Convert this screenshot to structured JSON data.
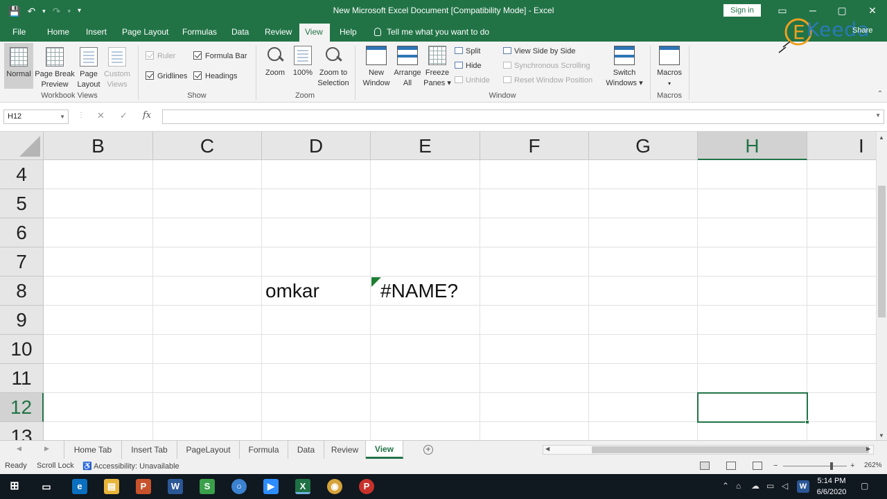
{
  "window": {
    "title": "New Microsoft Excel Document  [Compatibility Mode]  -  Excel",
    "signin": "Sign in",
    "share": "Share",
    "controls": [
      "─",
      "▢",
      "✕"
    ],
    "qat": [
      "💾",
      "↶",
      "▾",
      "↷",
      "▾"
    ]
  },
  "ribbon_tabs": [
    "File",
    "Home",
    "Insert",
    "Page Layout",
    "Formulas",
    "Data",
    "Review",
    "View",
    "Help"
  ],
  "active_tab": "View",
  "tell_me": "Tell me what you want to do",
  "ribbon": {
    "workbook_views": {
      "label": "Workbook Views",
      "normal": "Normal",
      "page_break_1": "Page Break",
      "page_break_2": "Preview",
      "page_layout_1": "Page",
      "page_layout_2": "Layout",
      "custom_1": "Custom",
      "custom_2": "Views"
    },
    "show": {
      "label": "Show",
      "ruler": "Ruler",
      "formula_bar": "Formula Bar",
      "gridlines": "Gridlines",
      "headings": "Headings"
    },
    "zoom": {
      "label": "Zoom",
      "zoom": "Zoom",
      "hundred": "100%",
      "zoom_sel_1": "Zoom to",
      "zoom_sel_2": "Selection"
    },
    "window": {
      "label": "Window",
      "new_1": "New",
      "new_2": "Window",
      "arrange_1": "Arrange",
      "arrange_2": "All",
      "freeze_1": "Freeze",
      "freeze_2": "Panes ▾",
      "split": "Split",
      "hide": "Hide",
      "unhide": "Unhide",
      "side_by_side": "View Side by Side",
      "sync_scroll": "Synchronous Scrolling",
      "reset_pos": "Reset Window Position",
      "switch_1": "Switch",
      "switch_2": "Windows ▾"
    },
    "macros": {
      "label": "Macros",
      "macros": "Macros",
      "arrow": "▾"
    }
  },
  "formula_bar": {
    "name_box": "H12",
    "cancel": "✕",
    "enter": "✓",
    "fx": "fx",
    "value": ""
  },
  "columns": [
    "B",
    "C",
    "D",
    "E",
    "F",
    "G",
    "H",
    "I"
  ],
  "rows": [
    "4",
    "5",
    "6",
    "7",
    "8",
    "9",
    "10",
    "11",
    "12",
    "13"
  ],
  "selected_column": "H",
  "selected_row": "12",
  "cells": {
    "D8": "omkar",
    "E8": "#NAME?"
  },
  "sheet_tabs": [
    "Home Tab",
    "Insert Tab",
    "PageLayout",
    "Formula",
    "Data",
    "Review",
    "View"
  ],
  "active_sheet": "View",
  "status": {
    "ready": "Ready",
    "scroll_lock": "Scroll Lock",
    "accessibility": "Accessibility: Unavailable",
    "zoom_level": "262%",
    "minus": "−",
    "plus": "+"
  },
  "taskbar": {
    "time": "5:14 PM",
    "date": "6/6/2020"
  },
  "logo": {
    "text": "Keeda"
  }
}
